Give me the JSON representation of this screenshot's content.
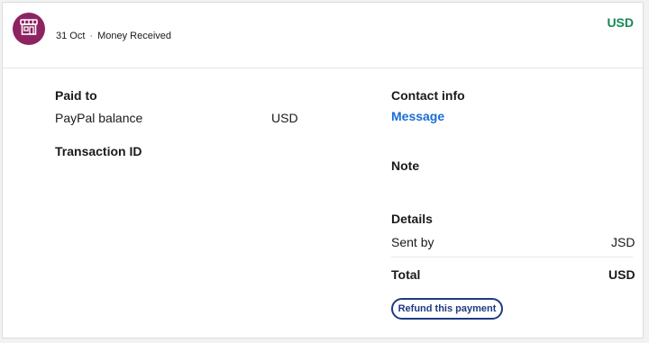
{
  "header": {
    "date": "31 Oct",
    "separator": "·",
    "status": "Money Received",
    "amount_currency": "USD"
  },
  "left": {
    "paid_to_label": "Paid to",
    "paid_to_account": "PayPal balance",
    "paid_to_currency": "USD",
    "transaction_id_label": "Transaction ID"
  },
  "right": {
    "contact_info_label": "Contact info",
    "message_link": "Message",
    "note_label": "Note",
    "details_label": "Details",
    "sent_by_label": "Sent by",
    "sent_by_currency": "JSD",
    "total_label": "Total",
    "total_currency": "USD",
    "refund_button": "Refund this payment"
  },
  "colors": {
    "avatar_bg": "#8e2361",
    "amount_green": "#138a55",
    "link_blue": "#1a6dd6",
    "button_navy": "#1f3a82"
  },
  "icons": {
    "avatar": "storefront-icon"
  }
}
